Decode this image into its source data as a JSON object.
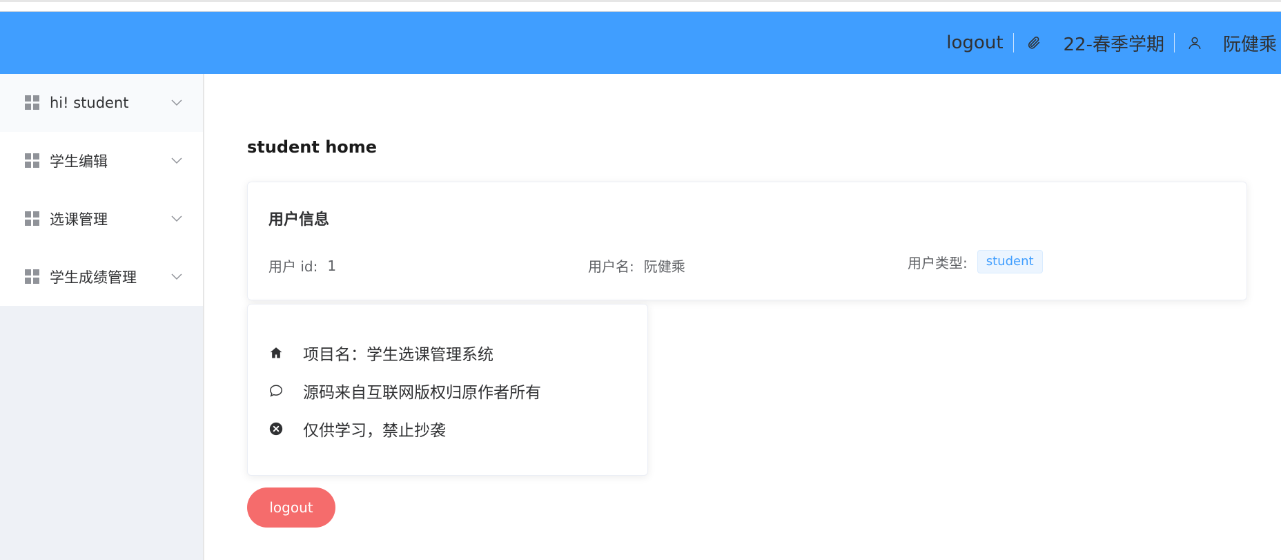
{
  "header": {
    "logout_label": "logout",
    "semester": "22-春季学期",
    "username": "阮健乘",
    "background_color": "#409eff",
    "icons": [
      "paperclip-icon",
      "user-icon"
    ]
  },
  "sidebar": {
    "items": [
      {
        "label": "hi! student",
        "icon": "grid-icon",
        "active": true
      },
      {
        "label": "学生编辑",
        "icon": "grid-icon"
      },
      {
        "label": "选课管理",
        "icon": "grid-icon"
      },
      {
        "label": "学生成绩管理",
        "icon": "grid-icon"
      }
    ]
  },
  "main": {
    "title": "student home",
    "user_card": {
      "title": "用户信息",
      "id_label": "用户 id:",
      "id_value": "1",
      "name_label": "用户名:",
      "name_value": "阮健乘",
      "type_label": "用户类型:",
      "type_value": "student"
    },
    "project_card": {
      "lines": [
        {
          "icon": "home-icon",
          "text": "项目名：学生选课管理系统"
        },
        {
          "icon": "chat-bubble-icon",
          "text": "源码来自互联网版权归原作者所有"
        },
        {
          "icon": "circle-close-icon",
          "text": "仅供学习，禁止抄袭"
        }
      ]
    },
    "logout_button": "logout",
    "logout_button_color": "#f56c6c"
  }
}
